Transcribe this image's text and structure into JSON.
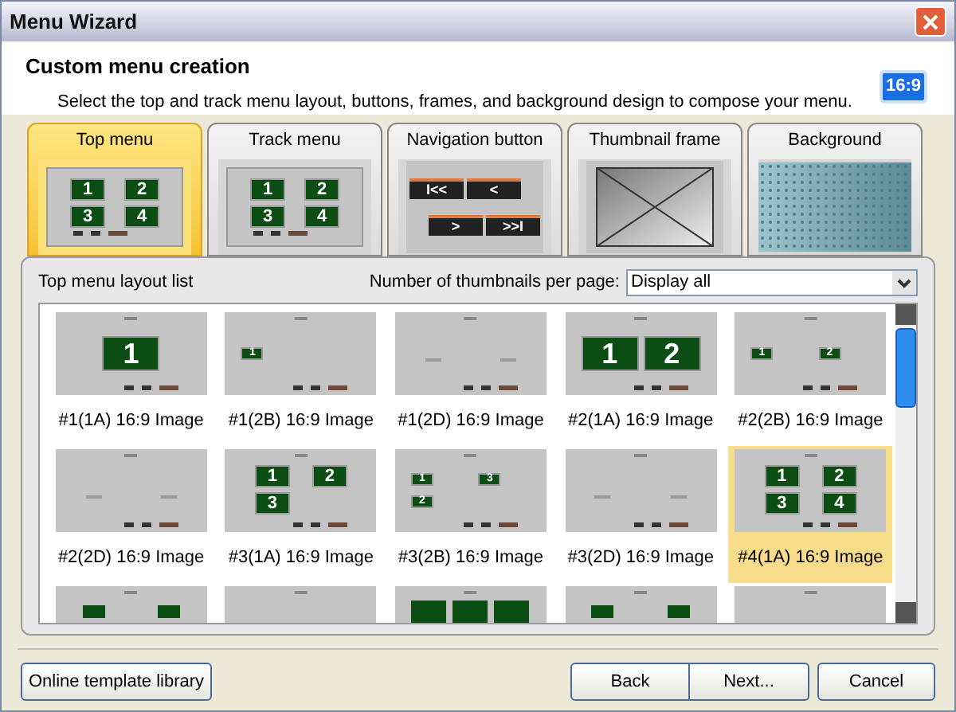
{
  "window": {
    "title": "Menu Wizard"
  },
  "header": {
    "title": "Custom menu creation",
    "description": "Select the top and track menu layout, buttons, frames, and background design to compose your menu.",
    "aspect_badge": "16:9"
  },
  "tabs": [
    {
      "label": "Top menu",
      "selected": true,
      "kind": "menu",
      "blocks": [
        "1",
        "2",
        "3",
        "4"
      ]
    },
    {
      "label": "Track menu",
      "selected": false,
      "kind": "menu",
      "blocks": [
        "1",
        "2",
        "3",
        "4"
      ]
    },
    {
      "label": "Navigation button",
      "selected": false,
      "kind": "buttons",
      "glyphs": [
        "I<<",
        "<",
        ">",
        ">>I"
      ]
    },
    {
      "label": "Thumbnail frame",
      "selected": false,
      "kind": "frame"
    },
    {
      "label": "Background",
      "selected": false,
      "kind": "background"
    }
  ],
  "list": {
    "title": "Top menu layout list",
    "per_page_label": "Number of thumbnails per page:",
    "per_page_value": "Display all",
    "items": [
      {
        "caption": "#1(1A) 16:9 Image",
        "kind": "large",
        "blocks": [
          "1"
        ],
        "selected": false
      },
      {
        "caption": "#1(2B) 16:9 Image",
        "kind": "small",
        "blocks": [
          "1"
        ],
        "selected": false
      },
      {
        "caption": "#1(2D) 16:9 Image",
        "kind": "text",
        "selected": false
      },
      {
        "caption": "#2(1A) 16:9 Image",
        "kind": "large",
        "blocks": [
          "1",
          "2"
        ],
        "selected": false
      },
      {
        "caption": "#2(2B) 16:9 Image",
        "kind": "small",
        "blocks": [
          "1",
          "2"
        ],
        "selected": false
      },
      {
        "caption": "#2(2D) 16:9 Image",
        "kind": "text",
        "selected": false
      },
      {
        "caption": "#3(1A) 16:9 Image",
        "kind": "grid",
        "blocks": [
          "1",
          "2",
          "3"
        ],
        "selected": false
      },
      {
        "caption": "#3(2B) 16:9 Image",
        "kind": "small",
        "blocks": [
          "1",
          "3",
          "2"
        ],
        "selected": false
      },
      {
        "caption": "#3(2D) 16:9 Image",
        "kind": "text",
        "selected": false
      },
      {
        "caption": "#4(1A) 16:9 Image",
        "kind": "grid",
        "blocks": [
          "1",
          "2",
          "3",
          "4"
        ],
        "selected": true
      },
      {
        "kind": "partial-pair",
        "selected": false
      },
      {
        "kind": "text",
        "selected": false
      },
      {
        "kind": "partial-row",
        "selected": false
      },
      {
        "kind": "partial-pair",
        "selected": false
      },
      {
        "kind": "text",
        "selected": false
      }
    ]
  },
  "buttons": {
    "library": "Online template library",
    "back": "Back",
    "next": "Next...",
    "cancel": "Cancel"
  }
}
